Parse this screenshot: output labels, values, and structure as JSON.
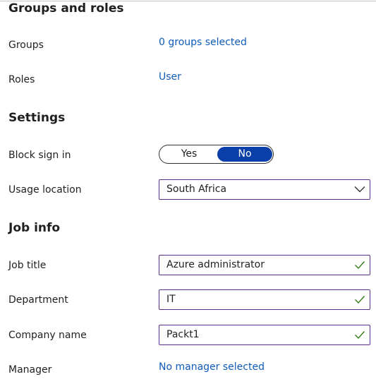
{
  "sections": {
    "groups_roles": {
      "title": "Groups and roles",
      "groups_label": "Groups",
      "groups_value": "0 groups selected",
      "roles_label": "Roles",
      "roles_value": "User"
    },
    "settings": {
      "title": "Settings",
      "block_sign_in_label": "Block sign in",
      "block_sign_in_options": [
        "Yes",
        "No"
      ],
      "block_sign_in_selected": "No",
      "usage_location_label": "Usage location",
      "usage_location_value": "South Africa"
    },
    "job_info": {
      "title": "Job info",
      "job_title_label": "Job title",
      "job_title_value": "Azure administrator",
      "department_label": "Department",
      "department_value": "IT",
      "company_label": "Company name",
      "company_value": "Packt1",
      "manager_label": "Manager",
      "manager_value": "No manager selected"
    }
  },
  "colors": {
    "link": "#0f5bb8",
    "toggle_selected": "#0a3ea8",
    "field_border": "#5c2d91",
    "valid_check": "#2e7d11"
  }
}
